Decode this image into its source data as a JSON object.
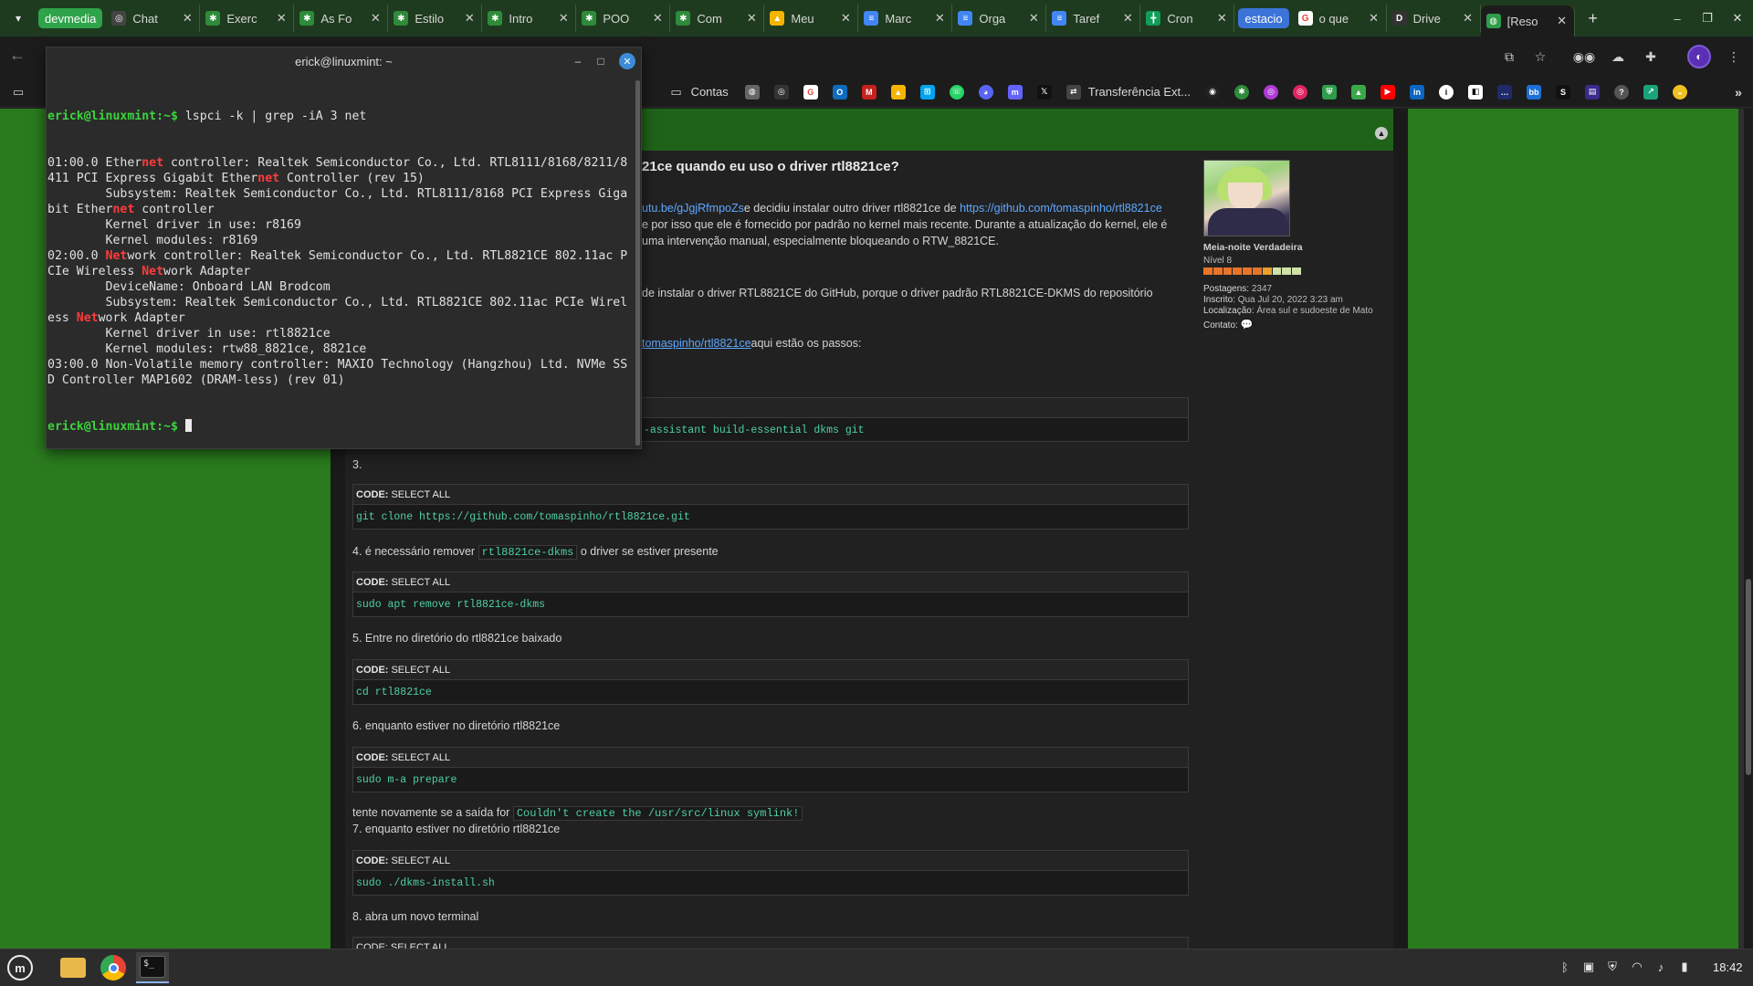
{
  "tabs": [
    {
      "label": "devmedia",
      "type": "group",
      "color": "#2fa34a"
    },
    {
      "label": "Chat",
      "icon": "openai-icon",
      "color": "#444444",
      "glyph": "◎"
    },
    {
      "label": "Exerc",
      "icon": "exercise-icon",
      "color": "#2e8b3a",
      "glyph": "✱"
    },
    {
      "label": "As Fo",
      "icon": "exercise-icon",
      "color": "#2e8b3a",
      "glyph": "✱"
    },
    {
      "label": "Estilo",
      "icon": "exercise-icon",
      "color": "#2e8b3a",
      "glyph": "✱"
    },
    {
      "label": "Intro",
      "icon": "exercise-icon",
      "color": "#2e8b3a",
      "glyph": "✱"
    },
    {
      "label": "POO",
      "icon": "exercise-icon",
      "color": "#2e8b3a",
      "glyph": "✱"
    },
    {
      "label": "Com",
      "icon": "exercise-icon",
      "color": "#2e8b3a",
      "glyph": "✱"
    },
    {
      "label": "Meu",
      "icon": "drive-icon",
      "color": "#f4b400",
      "glyph": "▲"
    },
    {
      "label": "Marc",
      "icon": "docs-icon",
      "color": "#4285f4",
      "glyph": "≡"
    },
    {
      "label": "Orga",
      "icon": "docs-icon",
      "color": "#4285f4",
      "glyph": "≡"
    },
    {
      "label": "Taref",
      "icon": "docs-icon",
      "color": "#4285f4",
      "glyph": "≡"
    },
    {
      "label": "Cron",
      "icon": "sheets-icon",
      "color": "#0f9d58",
      "glyph": "╋"
    },
    {
      "label": "estacio",
      "type": "group",
      "color": "#3b73d9"
    },
    {
      "label": "o que",
      "icon": "google-icon",
      "color": "#ffffff",
      "glyph": "G"
    },
    {
      "label": "Drive",
      "icon": "drive-icon",
      "color": "#333333",
      "glyph": "D"
    },
    {
      "label": "[Reso",
      "icon": "forum-icon",
      "color": "#2e9d4a",
      "glyph": "◍",
      "active": true
    }
  ],
  "bookmarks": {
    "folder_label": "Contas",
    "ext_label": "Transferência Ext..."
  },
  "terminal": {
    "title": "erick@linuxmint: ~",
    "prompt": "erick@linuxmint:~$",
    "command": " lspci -k | grep -iA 3 net",
    "lines": [
      [
        [
          "",
          "01:00.0 Ether"
        ],
        [
          "hl",
          "net"
        ],
        [
          "",
          " controller: Realtek Semiconductor Co., Ltd. RTL8111/8168/8211/8"
        ]
      ],
      [
        [
          "",
          "411 PCI Express Gigabit Ether"
        ],
        [
          "hl",
          "net"
        ],
        [
          "",
          " Controller (rev 15)"
        ]
      ],
      [
        [
          "",
          "        Subsystem: Realtek Semiconductor Co., Ltd. RTL8111/8168 PCI Express Giga"
        ]
      ],
      [
        [
          "",
          "bit Ether"
        ],
        [
          "hl",
          "net"
        ],
        [
          "",
          " controller"
        ]
      ],
      [
        [
          "",
          "        Kernel driver in use: r8169"
        ]
      ],
      [
        [
          "",
          "        Kernel modules: r8169"
        ]
      ],
      [
        [
          "",
          "02:00.0 "
        ],
        [
          "hl",
          "Net"
        ],
        [
          "",
          "work controller: Realtek Semiconductor Co., Ltd. RTL8821CE 802.11ac P"
        ]
      ],
      [
        [
          "",
          "CIe Wireless "
        ],
        [
          "hl",
          "Net"
        ],
        [
          "",
          "work Adapter"
        ]
      ],
      [
        [
          "",
          "        DeviceName: Onboard LAN Brodcom"
        ]
      ],
      [
        [
          "",
          "        Subsystem: Realtek Semiconductor Co., Ltd. RTL8821CE 802.11ac PCIe Wirel"
        ]
      ],
      [
        [
          "",
          "ess "
        ],
        [
          "hl",
          "Net"
        ],
        [
          "",
          "work Adapter"
        ]
      ],
      [
        [
          "",
          "        Kernel driver in use: rtl8821ce"
        ]
      ],
      [
        [
          "",
          "        Kernel modules: rtw88_8821ce, 8821ce"
        ]
      ],
      [
        [
          "",
          "03:00.0 Non-Volatile memory controller: MAXIO Technology (Hangzhou) Ltd. NVMe SS"
        ]
      ],
      [
        [
          "",
          "D Controller MAP1602 (DRAM-less) (rev 01)"
        ]
      ]
    ]
  },
  "post": {
    "title_fragment": "21ce quando eu uso o driver rtl8821ce?",
    "p1_link1": "utu.be/gJgjRfmpoZs",
    "p1_text1": "e decidiu instalar outro driver rtl8821ce de ",
    "p1_link2": "https://github.com/tomaspinho/rtl8821ce",
    "p2": "e por isso que ele é fornecido por padrão no kernel mais recente. Durante a atualização do kernel, ele é",
    "p3": "uma intervenção manual, especialmente bloqueando o RTW_8821CE.",
    "p4": "de instalar o driver RTL8821CE do GitHub, porque o driver padrão RTL8821CE-DKMS do repositório",
    "p5_link": "tomaspinho/rtl8821ce",
    "p5_text": "aqui estão os passos:",
    "code_partial": "-assistant build-essential dkms git",
    "step3": "3.",
    "code_label": "CODE:",
    "select_all": "SELECT ALL",
    "code3": "git clone https://github.com/tomaspinho/rtl8821ce.git",
    "step4_pre": "4. é necessário remover ",
    "step4_code": "rtl8821ce-dkms",
    "step4_post": " o driver se estiver presente",
    "code4": "sudo apt remove rtl8821ce-dkms",
    "step5": "5. Entre no diretório do rtl8821ce baixado",
    "code5": "cd rtl8821ce",
    "step6": "6. enquanto estiver no diretório rtl8821ce",
    "code6": "sudo m-a prepare",
    "retry_pre": "tente novamente se a saída for ",
    "retry_code": "Couldn't create the /usr/src/linux symlink!",
    "step7": "7. enquanto estiver no diretório rtl8821ce",
    "code7": " sudo ./dkms-install.sh",
    "step8": "8. abra um novo terminal",
    "code8_label": "CODE: SELECT ALL"
  },
  "profile": {
    "name": "Meia-noite Verdadeira",
    "rank": "Nível 8",
    "posts_label": "Postagens:",
    "posts": "2347",
    "joined_label": "Inscrito:",
    "joined": "Qua Jul 20, 2022 3:23 am",
    "location_label": "Localização:",
    "location": "Área sul e sudoeste de Mato",
    "contact_label": "Contato:"
  },
  "taskbar": {
    "clock": "18:42"
  },
  "colors": {
    "page_green": "#2a7a1e",
    "prompt_green": "#3dd43d",
    "highlight_red": "#ff3b3b",
    "link_blue": "#5fa8ff",
    "code_green": "#4fd0a4"
  }
}
